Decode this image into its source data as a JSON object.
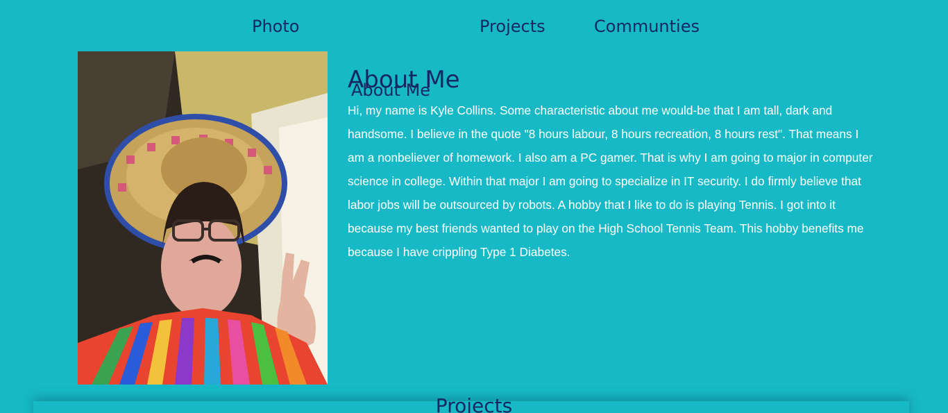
{
  "nav": {
    "items": [
      {
        "label": "Photo"
      },
      {
        "label": "About Me"
      },
      {
        "label": "Projects"
      },
      {
        "label": "Communties"
      }
    ]
  },
  "about": {
    "heading": "About Me",
    "body": "Hi, my name is Kyle Collins. Some characteristic about me would-be that I am tall, dark and handsome. I believe in the quote \"8 hours labour, 8 hours recreation, 8 hours rest\". That means I am a nonbeliever of homework. I also am a PC gamer. That is why I am going to major in computer science in college. Within that major I am going to specialize in IT security. I do firmly believe that labor jobs will be outsourced by robots. A hobby that I like to do is playing Tennis. I got into it because my best friends wanted to play on the High School Tennis Team. This hobby benefits me because I have crippling Type 1 Diabetes."
  },
  "projects": {
    "heading": "Projects"
  },
  "colors": {
    "background": "#17b9c6",
    "heading": "#162766",
    "body_text": "#ffffff"
  }
}
